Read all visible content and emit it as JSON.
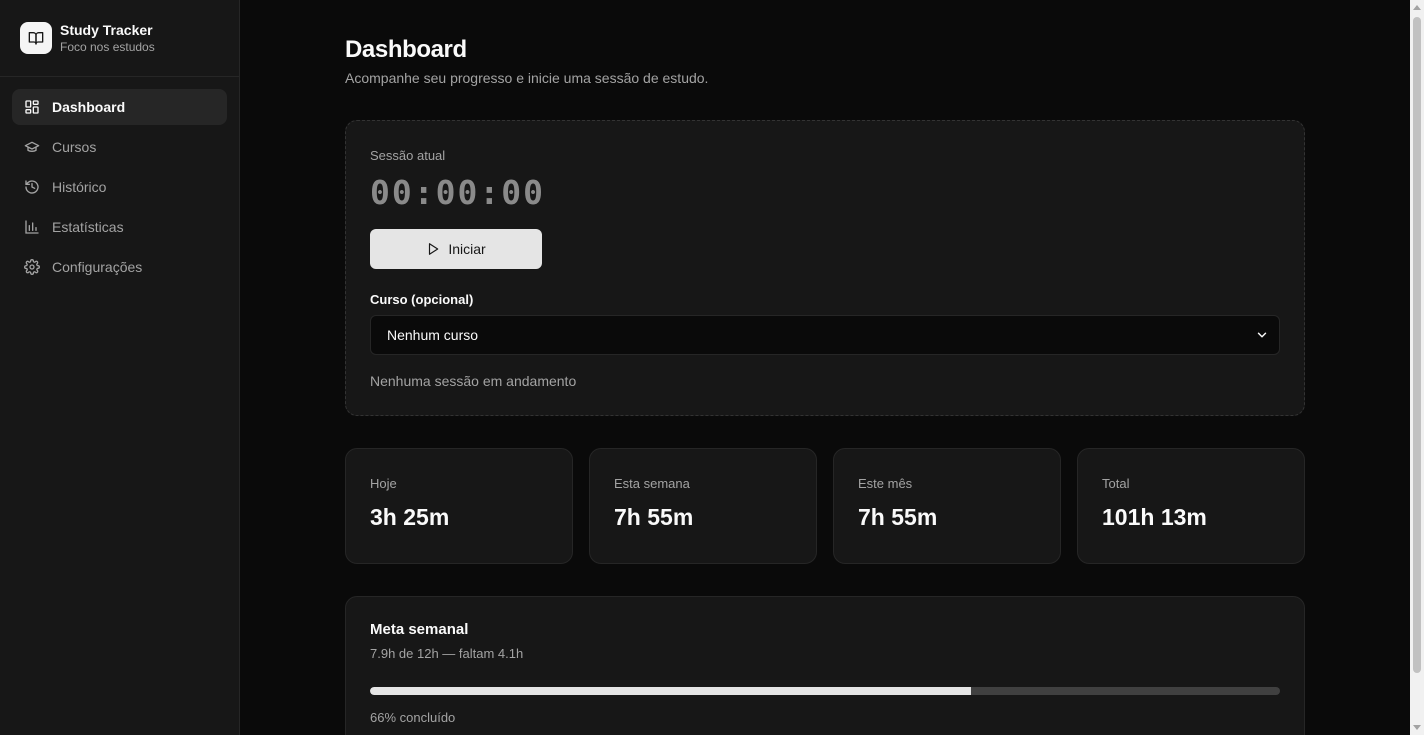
{
  "app": {
    "title": "Study Tracker",
    "subtitle": "Foco nos estudos",
    "logo_icon": "book-open-icon"
  },
  "sidebar": {
    "items": [
      {
        "label": "Dashboard",
        "icon": "dashboard-grid-icon",
        "active": true
      },
      {
        "label": "Cursos",
        "icon": "graduation-cap-icon",
        "active": false
      },
      {
        "label": "Histórico",
        "icon": "history-icon",
        "active": false
      },
      {
        "label": "Estatísticas",
        "icon": "bar-chart-icon",
        "active": false
      },
      {
        "label": "Configurações",
        "icon": "gear-icon",
        "active": false
      }
    ]
  },
  "header": {
    "title": "Dashboard",
    "subtitle": "Acompanhe seu progresso e inicie uma sessão de estudo."
  },
  "session": {
    "label": "Sessão atual",
    "timer": "00:00:00",
    "start_label": "Iniciar",
    "course_label": "Curso (opcional)",
    "course_selected": "Nenhum curso",
    "status": "Nenhuma sessão em andamento"
  },
  "stats": [
    {
      "label": "Hoje",
      "value": "3h 25m"
    },
    {
      "label": "Esta semana",
      "value": "7h 55m"
    },
    {
      "label": "Este mês",
      "value": "7h 55m"
    },
    {
      "label": "Total",
      "value": "101h 13m"
    }
  ],
  "goal": {
    "title": "Meta semanal",
    "detail": "7.9h de 12h — faltam 4.1h",
    "progress_percent": 66,
    "progress_label": "66% concluído"
  },
  "colors": {
    "background": "#0a0a0a",
    "card": "#171717",
    "border": "#262626",
    "muted_text": "#a3a3a3",
    "accent": "#e5e5e5"
  }
}
